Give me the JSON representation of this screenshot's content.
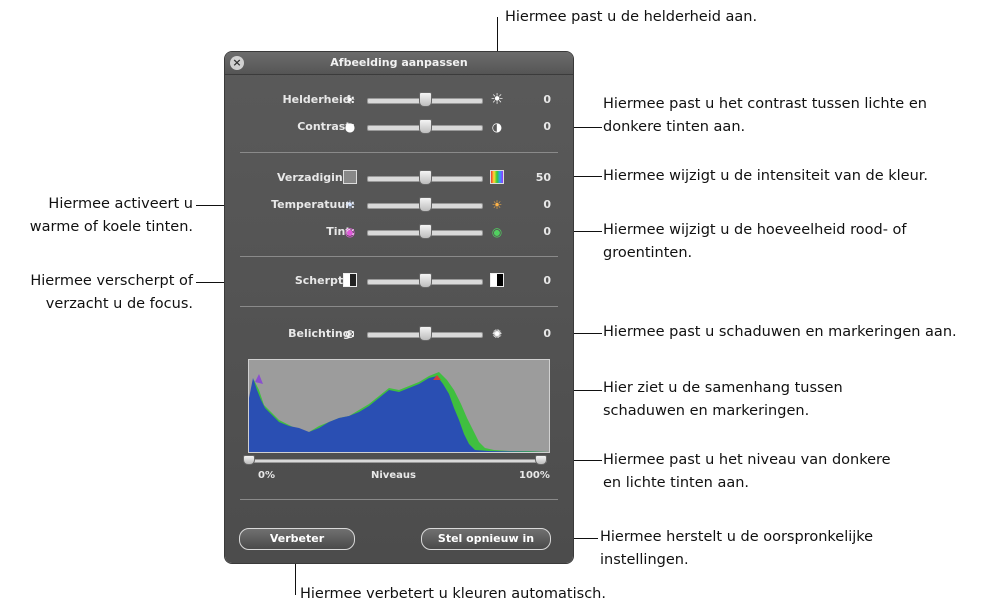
{
  "panel": {
    "title": "Afbeelding aanpassen",
    "close_icon": "close-icon",
    "sliders": [
      {
        "label": "Helderheid:",
        "value": "0",
        "level": 0.5
      },
      {
        "label": "Contrast:",
        "value": "0",
        "level": 0.5
      },
      {
        "label": "Verzadiging:",
        "value": "50",
        "level": 0.5
      },
      {
        "label": "Temperatuur:",
        "value": "0",
        "level": 0.5
      },
      {
        "label": "Tint:",
        "value": "0",
        "level": 0.5
      },
      {
        "label": "Scherpte:",
        "value": "0",
        "level": 0.5
      },
      {
        "label": "Belichting:",
        "value": "0",
        "level": 0.5
      }
    ],
    "levels": {
      "label": "Niveaus",
      "min": "0%",
      "max": "100%",
      "min_level": 0.0,
      "max_level": 1.0
    },
    "buttons": {
      "enhance": "Verbeter",
      "reset": "Stel opnieuw in"
    }
  },
  "callouts": {
    "brightness": "Hiermee past u de helderheid aan.",
    "contrast_1": "Hiermee past u het contrast tussen lichte en",
    "contrast_2": "donkere tinten aan.",
    "saturation": "Hiermee wijzigt u de intensiteit van de kleur.",
    "temperature_1": "Hiermee activeert u",
    "temperature_2": "warme of koele tinten.",
    "tint_1": "Hiermee wijzigt u de hoeveelheid rood- of",
    "tint_2": "groentinten.",
    "sharpness_1": "Hiermee verscherpt of",
    "sharpness_2": "verzacht u de focus.",
    "exposure": "Hiermee past u schaduwen en markeringen aan.",
    "histogram_1": "Hier ziet u de samenhang tussen",
    "histogram_2": "schaduwen en markeringen.",
    "levels_1": "Hiermee past u het niveau van donkere",
    "levels_2": "en lichte tinten aan.",
    "reset_1": "Hiermee herstelt u de oorspronkelijke",
    "reset_2": "instellingen.",
    "enhance": "Hiermee verbetert u kleuren automatisch."
  },
  "colors": {
    "panel_bg": "#4f4f4f",
    "histogram_bg": "#9c9c9c",
    "hist_blue": "#2a4fb3",
    "hist_green": "#3fbf3f",
    "hist_red": "#d33b3b"
  }
}
